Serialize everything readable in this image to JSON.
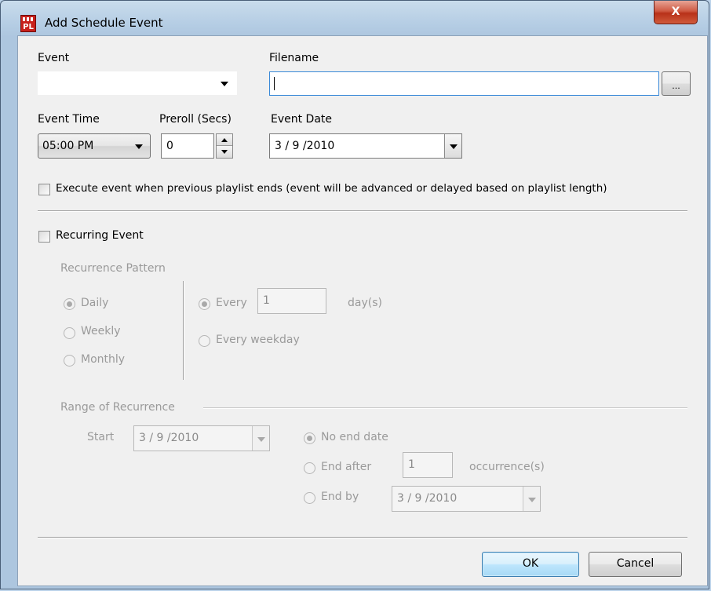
{
  "window": {
    "title": "Add Schedule Event",
    "close_glyph": "X",
    "icon": "pl-app-icon",
    "accent": "#c8201b"
  },
  "event": {
    "label": "Event",
    "value": ""
  },
  "filename": {
    "label": "Filename",
    "value": "",
    "browse_label": "..."
  },
  "event_time": {
    "label": "Event Time",
    "value": "05:00 PM"
  },
  "preroll": {
    "label": "Preroll (Secs)",
    "value": "0"
  },
  "event_date": {
    "label": "Event Date",
    "value": "3 / 9 /2010"
  },
  "execute_after_playlist": {
    "label": "Execute event when previous playlist ends (event will be advanced or delayed based on playlist length)",
    "checked": false
  },
  "recurring": {
    "label": "Recurring Event",
    "checked": false
  },
  "recurrence_pattern": {
    "title": "Recurrence Pattern",
    "options": [
      "Daily",
      "Weekly",
      "Monthly"
    ],
    "selected": "Daily",
    "every_label": "Every",
    "every_value": "1",
    "unit_label": "day(s)",
    "every_weekday_label": "Every weekday"
  },
  "range": {
    "title": "Range of Recurrence",
    "start_label": "Start",
    "start_value": "3 / 9 /2010",
    "no_end_label": "No end date",
    "end_after_label": "End after",
    "occurrences_value": "1",
    "occurrences_label": "occurrence(s)",
    "end_by_label": "End by",
    "end_by_value": "3 / 9 /2010",
    "selected": "No end date"
  },
  "buttons": {
    "ok": "OK",
    "cancel": "Cancel"
  }
}
